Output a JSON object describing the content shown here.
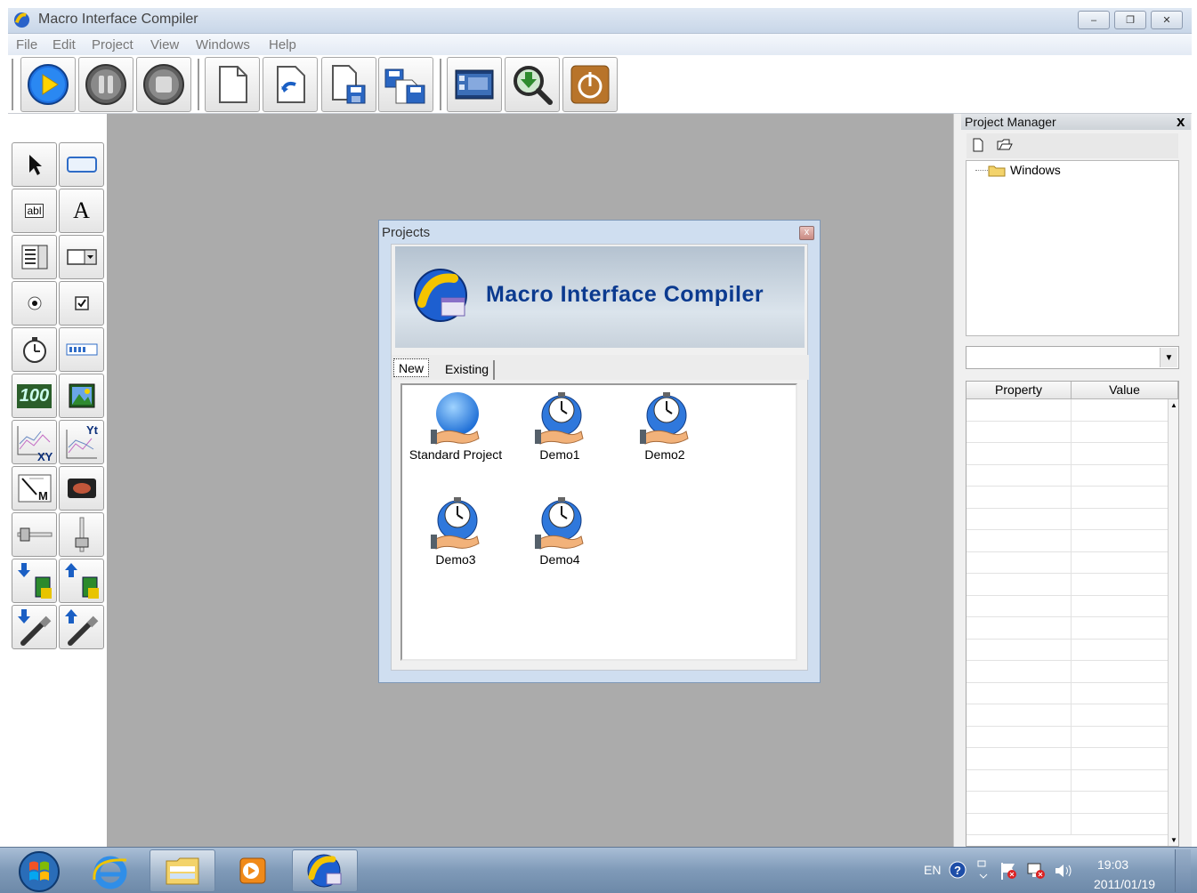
{
  "window": {
    "title": "Macro Interface Compiler",
    "controls": {
      "minimize": "–",
      "restore": "❐",
      "close": "✕"
    }
  },
  "menu": [
    "File",
    "Edit",
    "Project",
    "View",
    "Windows",
    "Help"
  ],
  "toolbar": {
    "buttons": [
      "run-icon",
      "pause-icon",
      "stop-icon",
      "new-file-icon",
      "open-icon",
      "save-icon",
      "save-all-icon",
      "screen-designer-icon",
      "search-download-icon",
      "power-icon"
    ]
  },
  "palette": {
    "tools": [
      [
        "pointer-icon",
        "rectangle-icon"
      ],
      [
        "textbox-icon",
        "label-icon"
      ],
      [
        "listbox-icon",
        "combobox-icon"
      ],
      [
        "radio-button-icon",
        "checkbox-icon"
      ],
      [
        "timer-icon",
        "progress-bar-icon"
      ],
      [
        "numeric-display-icon",
        "image-icon"
      ],
      [
        "xy-graph-icon",
        "yt-graph-icon"
      ],
      [
        "meter-icon",
        "led-icon"
      ],
      [
        "horizontal-slider-icon",
        "vertical-slider-icon"
      ],
      [
        "download-chip-icon",
        "upload-chip-icon"
      ],
      [
        "download-usb-icon",
        "upload-usb-icon"
      ]
    ],
    "text": {
      "label_glyph": "A",
      "textbox_glyph": "abl",
      "numeric_glyph": "100",
      "xy_glyph": "XY",
      "yt_glyph": "Yt",
      "meter_glyph": "M"
    }
  },
  "project_manager": {
    "title": "Project Manager",
    "close": "x",
    "tree": [
      {
        "label": "Windows"
      }
    ],
    "combo_value": "",
    "grid_columns": [
      "Property",
      "Value"
    ]
  },
  "dialog": {
    "title": "Projects",
    "close": "x",
    "banner_title": "Macro Interface Compiler",
    "tabs": [
      "New",
      "Existing"
    ],
    "active_tab": "New",
    "items": [
      {
        "label": "Standard Project",
        "icon": "globe-icon"
      },
      {
        "label": "Demo1",
        "icon": "stopwatch-icon"
      },
      {
        "label": "Demo2",
        "icon": "stopwatch-icon"
      },
      {
        "label": "Demo3",
        "icon": "stopwatch-icon"
      },
      {
        "label": "Demo4",
        "icon": "stopwatch-icon"
      }
    ]
  },
  "taskbar": {
    "tasks": [
      "start-orb-icon",
      "internet-explorer-icon",
      "file-explorer-icon",
      "media-player-icon",
      "macro-interface-compiler-icon"
    ],
    "tray": {
      "language": "EN",
      "time": "19:03",
      "date": "2011/01/19"
    }
  },
  "colors": {
    "workspace": "#ababab",
    "banner_text": "#0b3a8f",
    "taskbar": "#7f9ab8"
  }
}
